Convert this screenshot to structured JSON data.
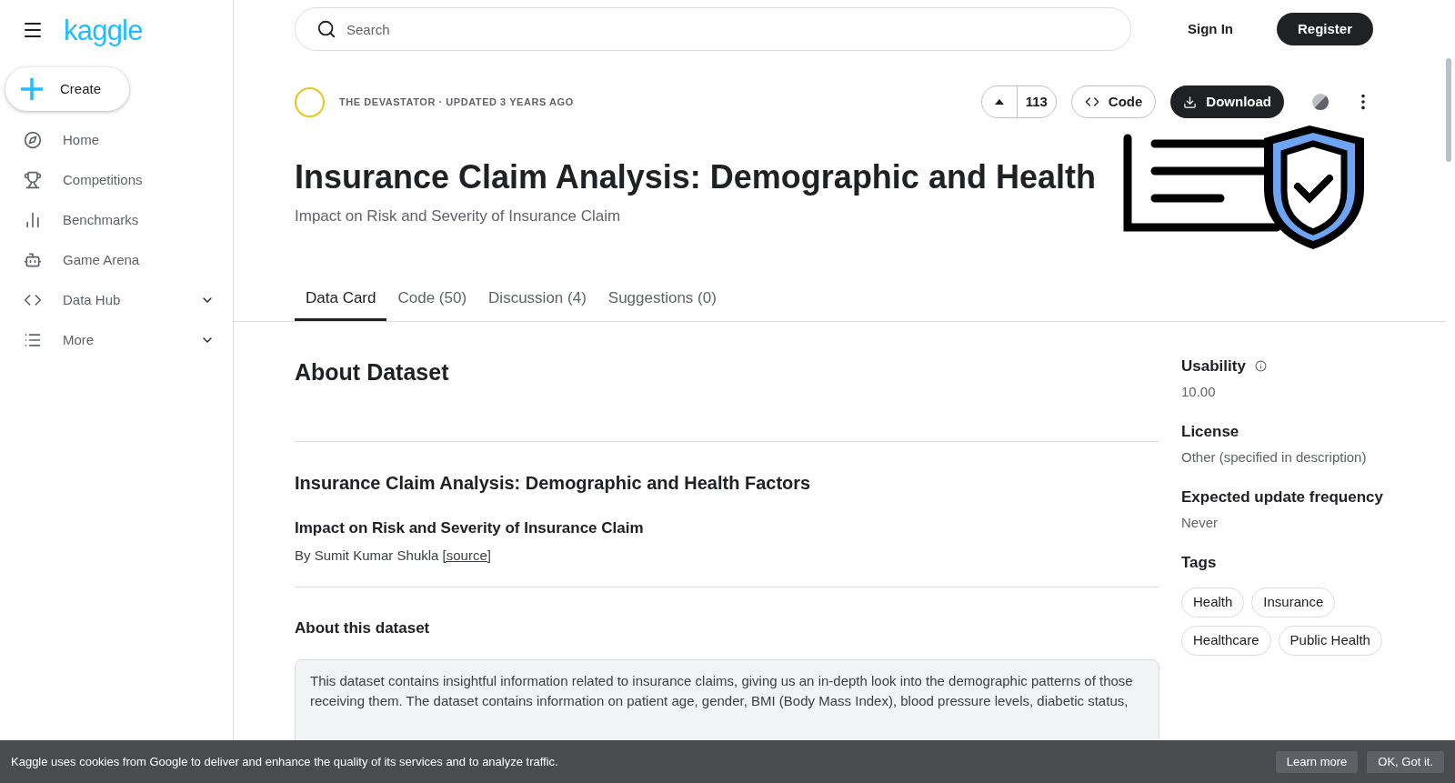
{
  "sidebar": {
    "logo": "kaggle",
    "create_label": "Create",
    "items": [
      {
        "label": "Home",
        "kind": "link",
        "selected": false
      },
      {
        "label": "Competitions",
        "kind": "link",
        "selected": false
      },
      {
        "label": "Benchmarks",
        "kind": "link",
        "selected": false
      },
      {
        "label": "Game Arena",
        "kind": "link",
        "selected": false
      },
      {
        "label": "Data Hub",
        "kind": "group",
        "selected": false
      },
      {
        "label": "More",
        "kind": "group",
        "selected": false
      }
    ]
  },
  "header": {
    "search": {
      "placeholder": "Search"
    },
    "sign_in": "Sign In",
    "register": "Register"
  },
  "dataset": {
    "meta": "THE DEVASTATOR · UPDATED 3 YEARS AGO",
    "votes": "113",
    "code_button": "Code",
    "download_button": "Download",
    "title": "Insurance Claim Analysis: Demographic and Health",
    "subtitle": "Impact on Risk and Severity of Insurance Claim"
  },
  "tabs": [
    {
      "label": "Data Card",
      "selected": true
    },
    {
      "label": "Code (50)",
      "selected": false
    },
    {
      "label": "Discussion (4)",
      "selected": false
    },
    {
      "label": "Suggestions (0)",
      "selected": false
    }
  ],
  "about": {
    "heading": "About Dataset",
    "section_title": "Insurance Claim Analysis: Demographic and Health Factors",
    "section_subtitle": "Impact on Risk and Severity of Insurance Claim",
    "byline": "By Sumit Kumar Shukla",
    "source_link": "[source]",
    "subheading": "About this dataset",
    "paragraph": "This dataset contains insightful information related to insurance claims, giving us an in-depth look into the demographic patterns of those receiving them. The dataset contains information on patient age, gender, BMI (Body Mass Index), blood pressure levels, diabetic status,"
  },
  "details": [
    {
      "label": "Usability",
      "value": "10.00",
      "info": true
    },
    {
      "label": "License",
      "value": "Other (specified in description)",
      "info": false
    },
    {
      "label": "Expected update frequency",
      "value": "Never",
      "info": false
    }
  ],
  "tags": {
    "label": "Tags",
    "items": [
      "Health",
      "Insurance",
      "Healthcare",
      "Public Health"
    ]
  },
  "cookie_bar": {
    "text": "Kaggle uses cookies from Google to deliver and enhance the quality of its services and to analyze traffic.",
    "learn_more": "Learn more",
    "ok": "OK, Got it."
  }
}
